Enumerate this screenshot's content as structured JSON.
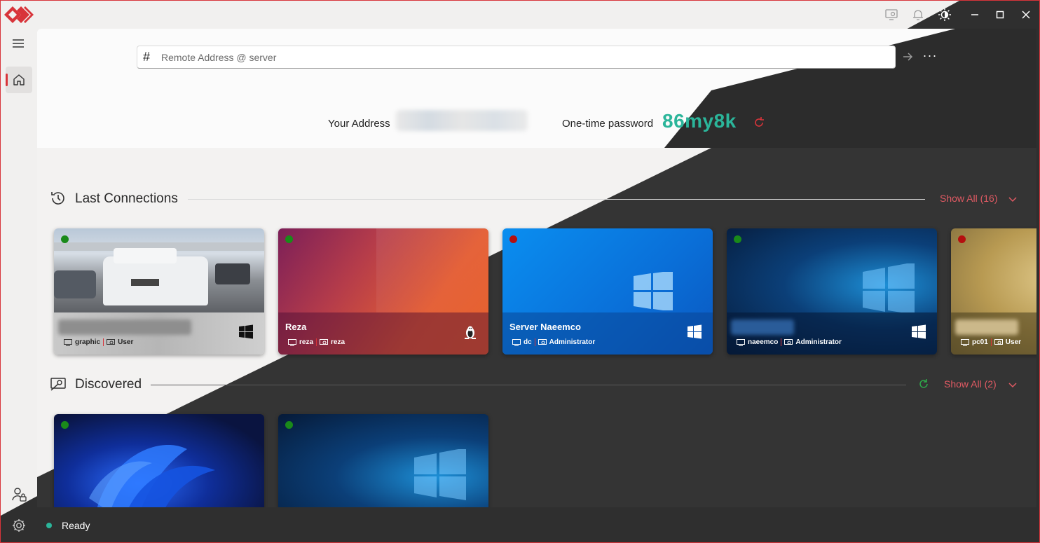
{
  "colors": {
    "accent": "#d8343a",
    "otp": "#2bb59a",
    "online": "#1a8a1a",
    "offline": "#b50f0f",
    "link": "#e05a63"
  },
  "titlebar": {
    "icons": [
      "screen-chat-icon",
      "bell-icon",
      "theme-toggle-icon"
    ],
    "controls": [
      "minimize-icon",
      "maximize-icon",
      "close-icon"
    ]
  },
  "sidebar": {
    "items": [
      {
        "icon": "menu-icon"
      },
      {
        "icon": "home-icon"
      }
    ],
    "bottom": [
      {
        "icon": "user-lock-icon"
      },
      {
        "icon": "gear-icon"
      }
    ]
  },
  "connect": {
    "hash": "#",
    "placeholder": "Remote Address @ server",
    "value": ""
  },
  "info": {
    "your_address_label": "Your Address",
    "otp_label": "One-time password",
    "otp": "86my8k"
  },
  "last_connections": {
    "title": "Last Connections",
    "show_all": "Show All (16)",
    "cards": [
      {
        "online": true,
        "name": "",
        "name_blurred": true,
        "device": "graphic",
        "user": "User",
        "os": "windows"
      },
      {
        "online": true,
        "name": "Reza",
        "device": "reza",
        "user": "reza",
        "os": "linux"
      },
      {
        "online": false,
        "name": "Server Naeemco",
        "device": "dc",
        "user": "Administrator",
        "os": "windows"
      },
      {
        "online": true,
        "name": "",
        "name_blurred": true,
        "device": "naeemco",
        "user": "Administrator",
        "os": "windows"
      },
      {
        "online": false,
        "name": "",
        "name_blurred": true,
        "device": "pc01",
        "user": "User",
        "os": "windows"
      }
    ]
  },
  "discovered": {
    "title": "Discovered",
    "show_all": "Show All (2)",
    "cards": [
      {
        "online": true
      },
      {
        "online": true
      }
    ]
  },
  "status": {
    "text": "Ready"
  }
}
